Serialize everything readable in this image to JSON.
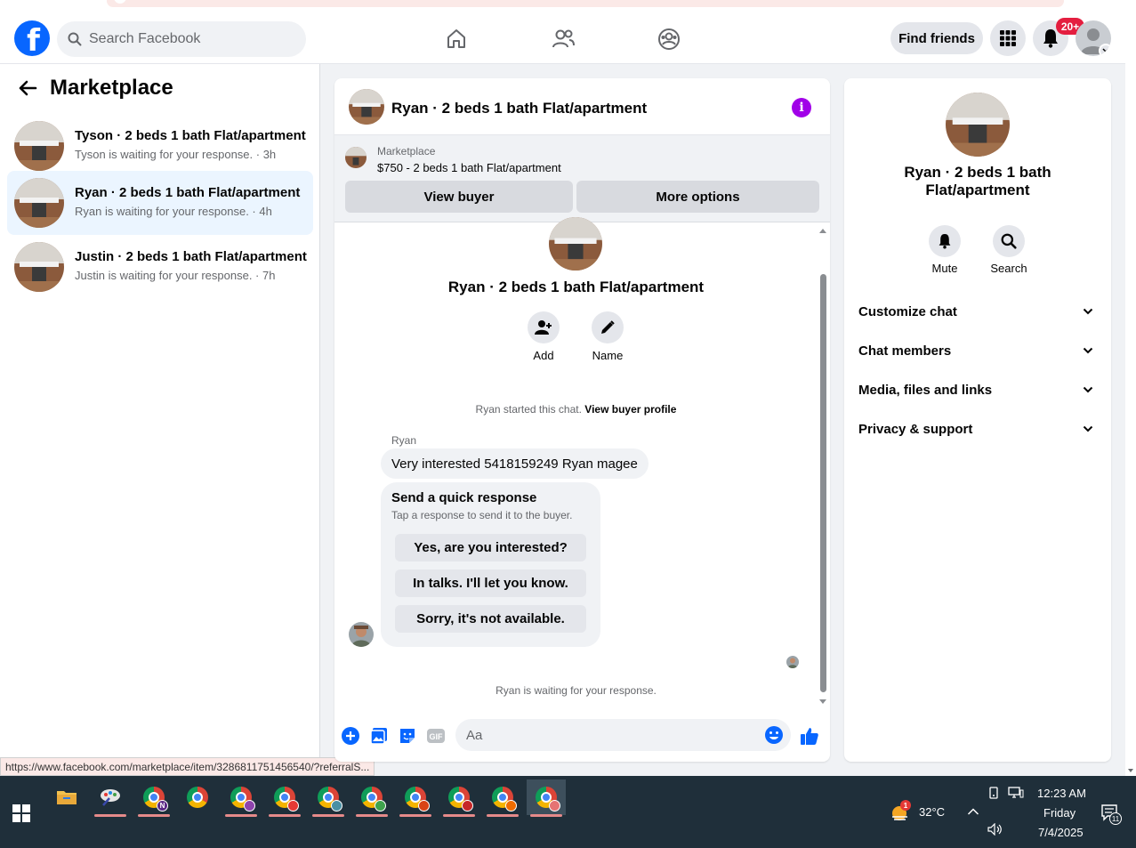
{
  "header": {
    "search_placeholder": "Search Facebook",
    "find_friends_label": "Find friends",
    "notification_badge": "20+"
  },
  "sidebar": {
    "title": "Marketplace",
    "conversations": [
      {
        "title": "Tyson · 2 beds 1 bath Flat/apartment",
        "subtitle": "Tyson is waiting for your response. · 3h"
      },
      {
        "title": "Ryan · 2 beds 1 bath Flat/apartment",
        "subtitle": "Ryan is waiting for your response. · 4h"
      },
      {
        "title": "Justin · 2 beds 1 bath Flat/apartment",
        "subtitle": "Justin is waiting for your response. · 7h"
      }
    ]
  },
  "status_url": "https://www.facebook.com/marketplace/item/3286811751456540/?referralS...",
  "chat": {
    "title": "Ryan · 2 beds 1 bath Flat/apartment",
    "listing_source": "Marketplace",
    "listing_text": "$750 - 2 beds 1 bath Flat/apartment",
    "view_buyer_label": "View buyer",
    "more_options_label": "More options",
    "intro_title": "Ryan · 2 beds 1 bath Flat/apartment",
    "add_label": "Add",
    "name_label": "Name",
    "started_text": "Ryan started this chat.",
    "view_profile_label": "View buyer profile",
    "sender_name": "Ryan",
    "message": "Very interested 5418159249 Ryan magee",
    "quick_title": "Send a quick response",
    "quick_subtitle": "Tap a response to send it to the buyer.",
    "quick_replies": [
      "Yes, are you interested?",
      "In talks. I'll let you know.",
      "Sorry, it's not available."
    ],
    "waiting_text": "Ryan is waiting for your response.",
    "composer_placeholder": "Aa"
  },
  "details": {
    "title_line1": "Ryan · 2 beds 1 bath",
    "title_line2": "Flat/apartment",
    "mute_label": "Mute",
    "search_label": "Search",
    "sections": [
      "Customize chat",
      "Chat members",
      "Media, files and links",
      "Privacy & support"
    ]
  },
  "taskbar": {
    "temperature": "32°C",
    "time": "12:23 AM",
    "day": "Friday",
    "date": "7/4/2025",
    "weather_badge": "1",
    "notification_count": "11"
  },
  "colors": {
    "brand": "#0866ff",
    "accent_purple": "#a100e8",
    "active_conversation": "#ebf5ff"
  }
}
